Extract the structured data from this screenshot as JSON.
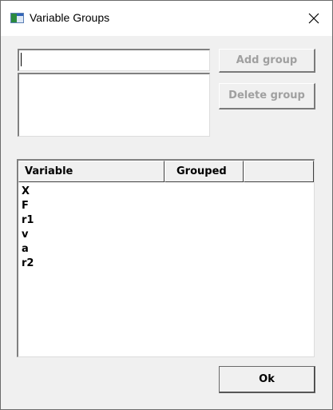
{
  "window": {
    "title": "Variable Groups"
  },
  "group_editor": {
    "name_value": "",
    "add_label": "Add group",
    "delete_label": "Delete group"
  },
  "variable_table": {
    "columns": [
      "Variable",
      "Grouped",
      ""
    ],
    "rows": [
      "X",
      "F",
      "r1",
      "v",
      "a",
      "r2"
    ]
  },
  "footer": {
    "ok_label": "Ok"
  }
}
